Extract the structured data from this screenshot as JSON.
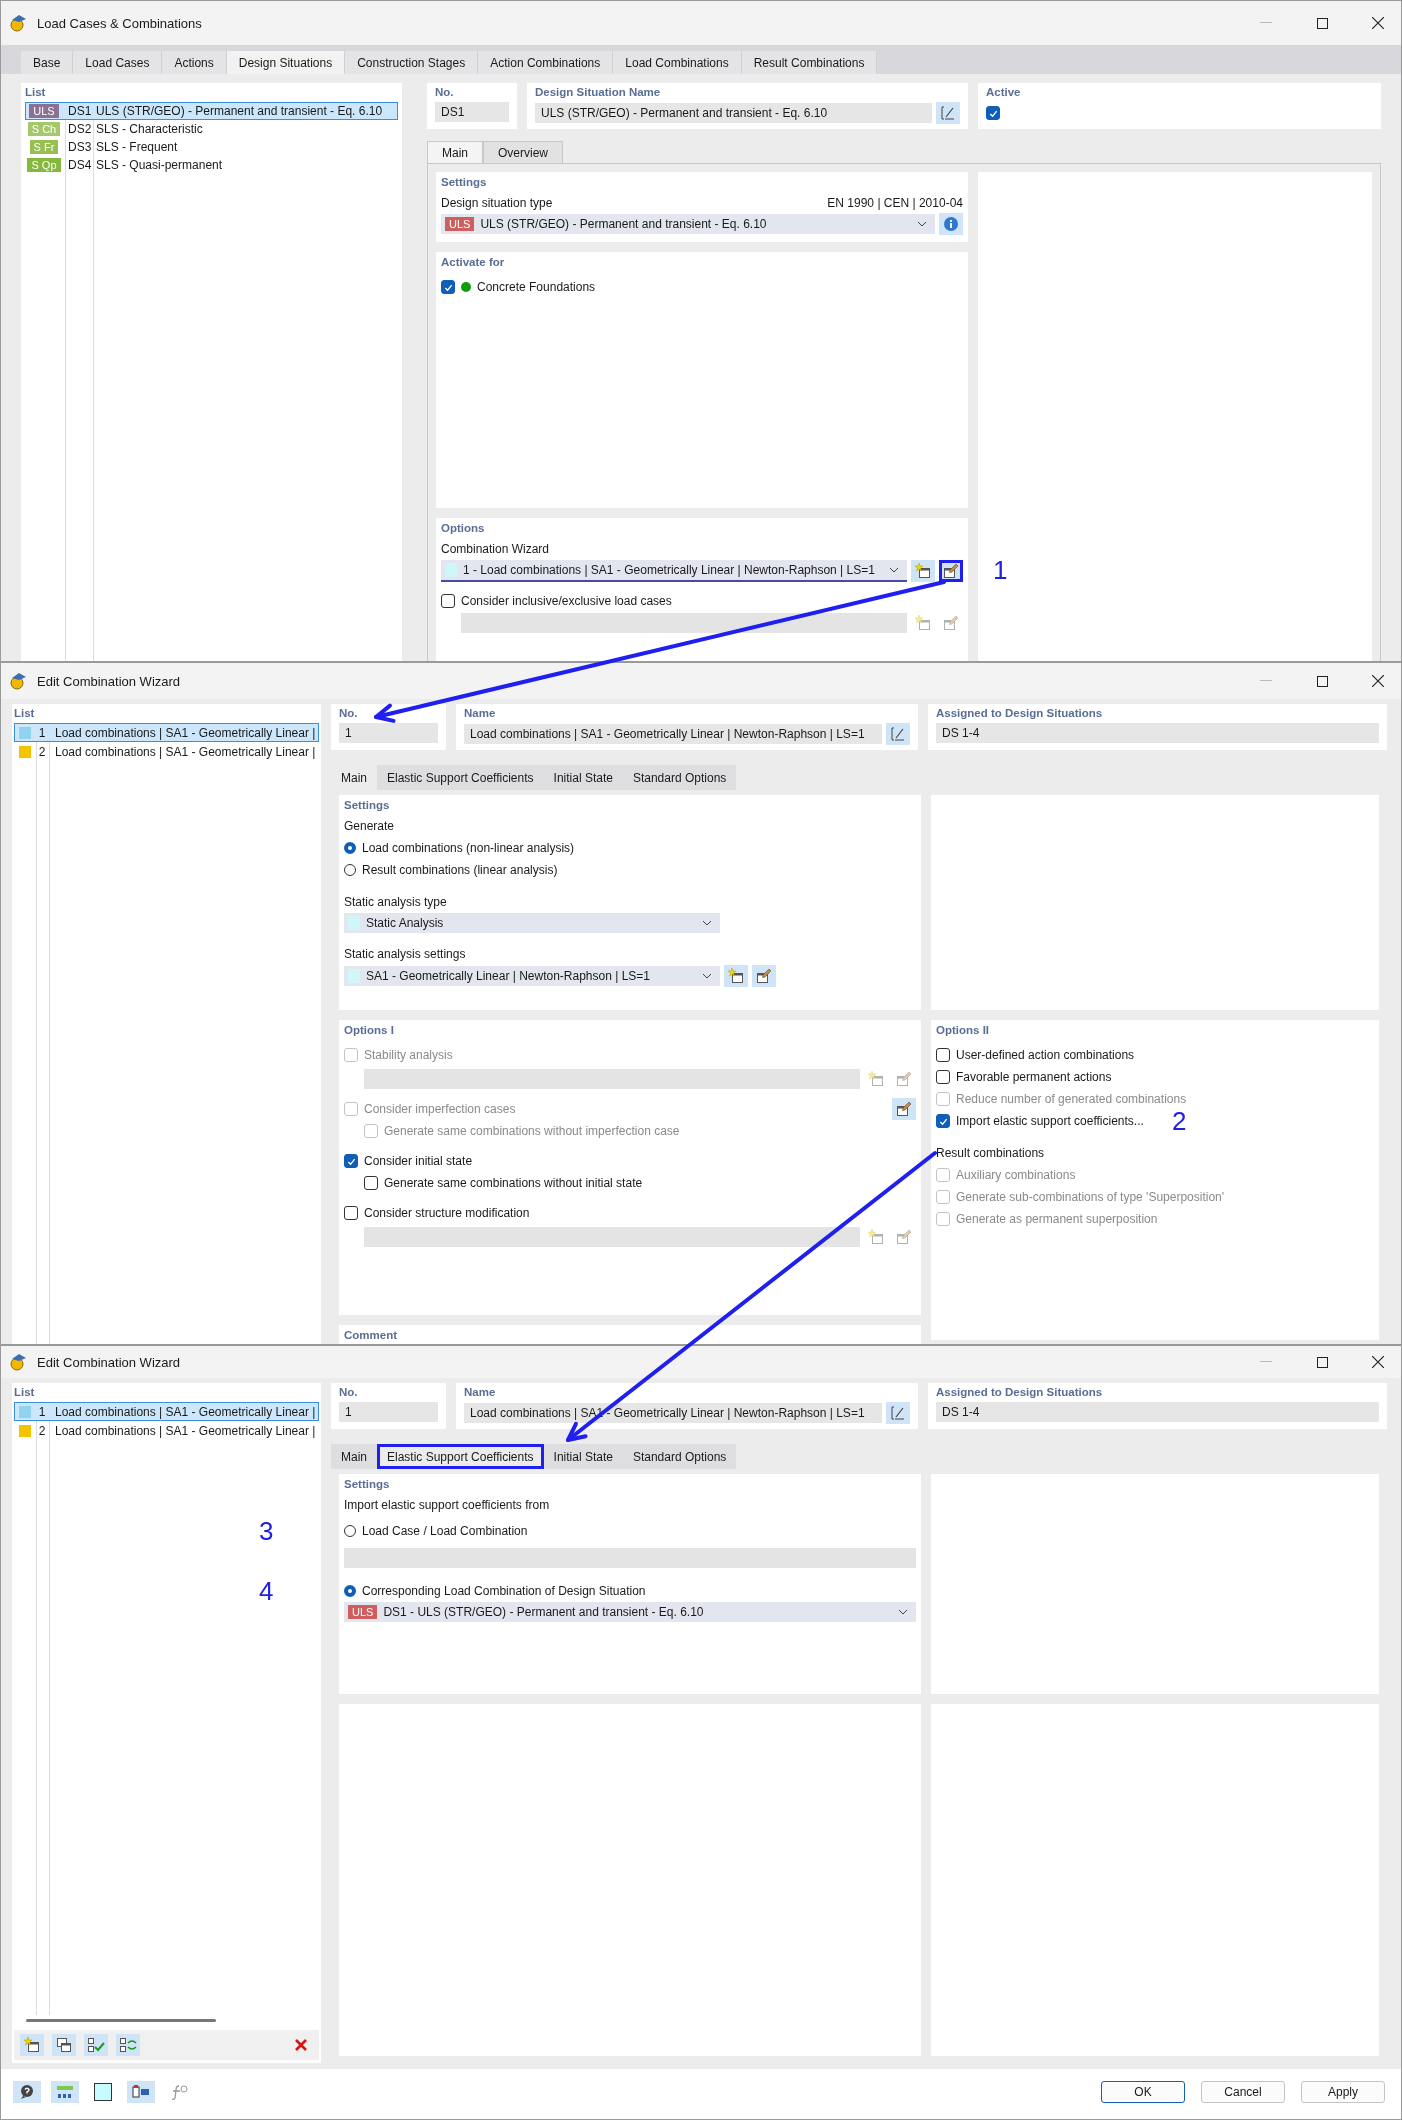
{
  "load_cases_window": {
    "title": "Load Cases & Combinations",
    "tabs": [
      {
        "label": "Base",
        "selected": false
      },
      {
        "label": "Load Cases",
        "selected": false
      },
      {
        "label": "Actions",
        "selected": false
      },
      {
        "label": "Design Situations",
        "selected": true
      },
      {
        "label": "Construction Stages",
        "selected": false
      },
      {
        "label": "Action Combinations",
        "selected": false
      },
      {
        "label": "Load Combinations",
        "selected": false
      },
      {
        "label": "Result Combinations",
        "selected": false
      }
    ],
    "list": {
      "title": "List",
      "items": [
        {
          "tag": "ULS",
          "color": "#8b7094",
          "no": "DS1",
          "name": "ULS (STR/GEO) - Permanent and transient - Eq. 6.10",
          "selected": true
        },
        {
          "tag": "S Ch",
          "color": "#a6c86c",
          "no": "DS2",
          "name": "SLS - Characteristic",
          "selected": false
        },
        {
          "tag": "S Fr",
          "color": "#98bf52",
          "no": "DS3",
          "name": "SLS - Frequent",
          "selected": false
        },
        {
          "tag": "S Qp",
          "color": "#86b840",
          "no": "DS4",
          "name": "SLS - Quasi-permanent",
          "selected": false
        }
      ]
    },
    "no": {
      "label": "No.",
      "value": "DS1"
    },
    "name": {
      "label": "Design Situation Name",
      "value": "ULS (STR/GEO) - Permanent and transient - Eq. 6.10"
    },
    "active": {
      "label": "Active",
      "checked": true
    },
    "subtabs": [
      {
        "label": "Main",
        "selected": true
      },
      {
        "label": "Overview",
        "selected": false
      }
    ],
    "settings": {
      "title": "Settings",
      "type_label": "Design situation type",
      "standard": "EN 1990 | CEN | 2010-04",
      "type": {
        "tag": "ULS",
        "color": "#cf5f5f",
        "value": "ULS (STR/GEO) - Permanent and transient - Eq. 6.10"
      }
    },
    "activate_for": {
      "title": "Activate for",
      "items": [
        {
          "label": "Concrete Foundations",
          "checked": true,
          "color": "#0f9d0f"
        }
      ]
    },
    "options": {
      "title": "Options",
      "wizard_label": "Combination Wizard",
      "wizard": {
        "value": "1 - Load combinations | SA1 - Geometrically Linear | Newton-Raphson | LS=1",
        "edit_highlighted": true,
        "callout": "1"
      },
      "checks": [
        {
          "label": "Consider inclusive/exclusive load cases",
          "checked": false
        }
      ]
    }
  },
  "main_wizard_window": {
    "title": "Edit Combination Wizard",
    "list": {
      "title": "List",
      "items": [
        {
          "color": "#8fd3ef",
          "no": "1",
          "name": "Load combinations | SA1 - Geometrically Linear |",
          "selected": true
        },
        {
          "color": "#f5c400",
          "no": "2",
          "name": "Load combinations | SA1 - Geometrically Linear |",
          "selected": false
        }
      ]
    },
    "no": {
      "label": "No.",
      "value": "1"
    },
    "name": {
      "label": "Name",
      "value": "Load combinations | SA1 - Geometrically Linear | Newton-Raphson | LS=1"
    },
    "assigned": {
      "label": "Assigned to Design Situations",
      "value": "DS 1-4"
    },
    "tabs": [
      {
        "label": "Main",
        "selected": true,
        "highlighted": false
      },
      {
        "label": "Elastic Support Coefficients",
        "selected": false,
        "highlighted": false
      },
      {
        "label": "Initial State",
        "selected": false,
        "highlighted": false
      },
      {
        "label": "Standard Options",
        "selected": false,
        "highlighted": false
      }
    ],
    "settings": {
      "title": "Settings",
      "generate_label": "Generate",
      "generate": [
        {
          "label": "Load combinations (non-linear analysis)",
          "selected": true
        },
        {
          "label": "Result combinations (linear analysis)",
          "selected": false
        }
      ],
      "analysis_type_label": "Static analysis type",
      "analysis_type": "Static Analysis",
      "analysis_settings_label": "Static analysis settings",
      "analysis_settings": "SA1 - Geometrically Linear | Newton-Raphson | LS=1"
    },
    "options_1": {
      "title": "Options I",
      "items": [
        {
          "label": "Stability analysis",
          "checked": false,
          "disabled": true,
          "field": true
        },
        {
          "label": "Consider imperfection cases",
          "checked": false,
          "disabled": true,
          "edit_button": true,
          "children": [
            {
              "label": "Generate same combinations without imperfection case",
              "checked": false,
              "disabled": true
            }
          ]
        },
        {
          "label": "Consider initial state",
          "checked": true,
          "disabled": false,
          "children": [
            {
              "label": "Generate same combinations without initial state",
              "checked": false,
              "disabled": false
            }
          ]
        },
        {
          "label": "Consider structure modification",
          "checked": false,
          "disabled": false,
          "field": true
        }
      ]
    },
    "options_2": {
      "title": "Options II",
      "items": [
        {
          "label": "User-defined action combinations",
          "checked": false,
          "disabled": false
        },
        {
          "label": "Favorable permanent actions",
          "checked": false,
          "disabled": false
        },
        {
          "label": "Reduce number of generated combinations",
          "checked": false,
          "disabled": true
        },
        {
          "label": "Import elastic support coefficients...",
          "checked": true,
          "disabled": false,
          "callout": "2"
        }
      ],
      "result_title": "Result combinations",
      "result_items": [
        {
          "label": "Auxiliary combinations",
          "checked": false,
          "disabled": true
        },
        {
          "label": "Generate sub-combinations of type 'Superposition'",
          "checked": false,
          "disabled": true
        },
        {
          "label": "Generate as permanent superposition",
          "checked": false,
          "disabled": true
        }
      ]
    },
    "comment_title": "Comment"
  },
  "elastic_wizard_window": {
    "title": "Edit Combination Wizard",
    "list": {
      "title": "List",
      "items": [
        {
          "color": "#8fd3ef",
          "no": "1",
          "name": "Load combinations | SA1 - Geometrically Linear |",
          "selected": true
        },
        {
          "color": "#f5c400",
          "no": "2",
          "name": "Load combinations | SA1 - Geometrically Linear |",
          "selected": false
        }
      ]
    },
    "no": {
      "label": "No.",
      "value": "1"
    },
    "name": {
      "label": "Name",
      "value": "Load combinations | SA1 - Geometrically Linear | Newton-Raphson | LS=1"
    },
    "assigned": {
      "label": "Assigned to Design Situations",
      "value": "DS 1-4"
    },
    "tabs": [
      {
        "label": "Main",
        "selected": false,
        "highlighted": false
      },
      {
        "label": "Elastic Support Coefficients",
        "selected": true,
        "highlighted": true
      },
      {
        "label": "Initial State",
        "selected": false,
        "highlighted": false
      },
      {
        "label": "Standard Options",
        "selected": false,
        "highlighted": false
      }
    ],
    "settings": {
      "title": "Settings",
      "intro": "Import elastic support coefficients from",
      "sources": [
        {
          "kind": "field",
          "label": "Load Case / Load Combination",
          "selected": false,
          "callout": "3"
        },
        {
          "kind": "dropdown",
          "label": "Corresponding Load Combination of Design Situation",
          "selected": true,
          "callout": "4",
          "tag": "ULS",
          "color": "#cf5f5f",
          "value": "DS1 - ULS (STR/GEO) - Permanent and transient - Eq. 6.10"
        }
      ]
    },
    "buttons": [
      {
        "label": "OK",
        "default": true
      },
      {
        "label": "Cancel",
        "default": false
      },
      {
        "label": "Apply",
        "default": false
      }
    ]
  }
}
